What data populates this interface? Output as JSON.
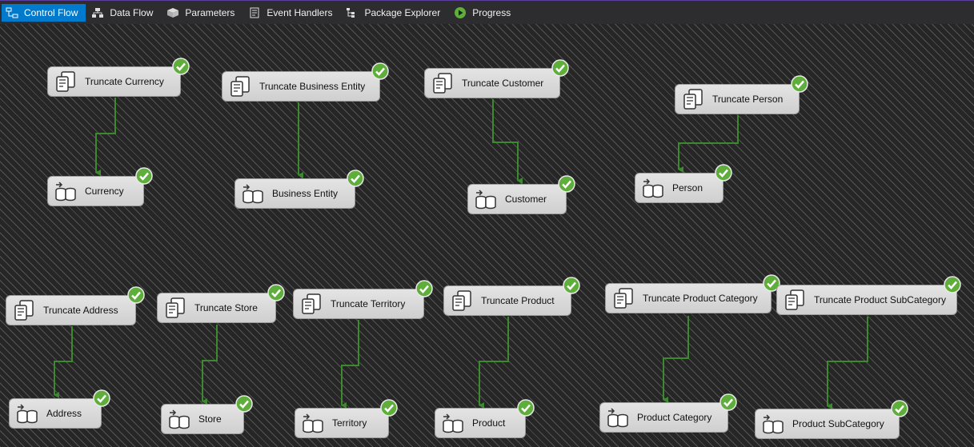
{
  "toolbar": {
    "tabs": [
      {
        "label": "Control Flow",
        "icon": "control-flow-icon",
        "active": true
      },
      {
        "label": "Data Flow",
        "icon": "data-flow-icon",
        "active": false
      },
      {
        "label": "Parameters",
        "icon": "parameters-icon",
        "active": false
      },
      {
        "label": "Event Handlers",
        "icon": "event-handlers-icon",
        "active": false
      },
      {
        "label": "Package Explorer",
        "icon": "package-explorer-icon",
        "active": false
      },
      {
        "label": "Progress",
        "icon": "progress-play-icon",
        "active": false
      }
    ]
  },
  "colors": {
    "accent": "#007acc",
    "success": "#5fae3c",
    "connector": "#3c8a2e",
    "task_bg": "#d8d8d8"
  },
  "tasks": {
    "truncate_currency": {
      "label": "Truncate Currency",
      "kind": "execute-sql",
      "status": "success"
    },
    "currency": {
      "label": "Currency",
      "kind": "data-flow",
      "status": "success"
    },
    "truncate_business_entity": {
      "label": "Truncate Business Entity",
      "kind": "execute-sql",
      "status": "success"
    },
    "business_entity": {
      "label": "Business Entity",
      "kind": "data-flow",
      "status": "success"
    },
    "truncate_customer": {
      "label": "Truncate Customer",
      "kind": "execute-sql",
      "status": "success"
    },
    "customer": {
      "label": "Customer",
      "kind": "data-flow",
      "status": "success"
    },
    "truncate_person": {
      "label": "Truncate Person",
      "kind": "execute-sql",
      "status": "success"
    },
    "person": {
      "label": "Person",
      "kind": "data-flow",
      "status": "success"
    },
    "truncate_address": {
      "label": "Truncate Address",
      "kind": "execute-sql",
      "status": "success"
    },
    "address": {
      "label": "Address",
      "kind": "data-flow",
      "status": "success"
    },
    "truncate_store": {
      "label": "Truncate Store",
      "kind": "execute-sql",
      "status": "success"
    },
    "store": {
      "label": "Store",
      "kind": "data-flow",
      "status": "success"
    },
    "truncate_territory": {
      "label": "Truncate Territory",
      "kind": "execute-sql",
      "status": "success"
    },
    "territory": {
      "label": "Territory",
      "kind": "data-flow",
      "status": "success"
    },
    "truncate_product": {
      "label": "Truncate Product",
      "kind": "execute-sql",
      "status": "success"
    },
    "product": {
      "label": "Product",
      "kind": "data-flow",
      "status": "success"
    },
    "truncate_product_category": {
      "label": "Truncate Product Category",
      "kind": "execute-sql",
      "status": "success"
    },
    "product_category": {
      "label": "Product Category",
      "kind": "data-flow",
      "status": "success"
    },
    "truncate_product_subcategory": {
      "label": "Truncate Product SubCategory",
      "kind": "execute-sql",
      "status": "success"
    },
    "product_subcategory": {
      "label": "Product SubCategory",
      "kind": "data-flow",
      "status": "success"
    }
  }
}
